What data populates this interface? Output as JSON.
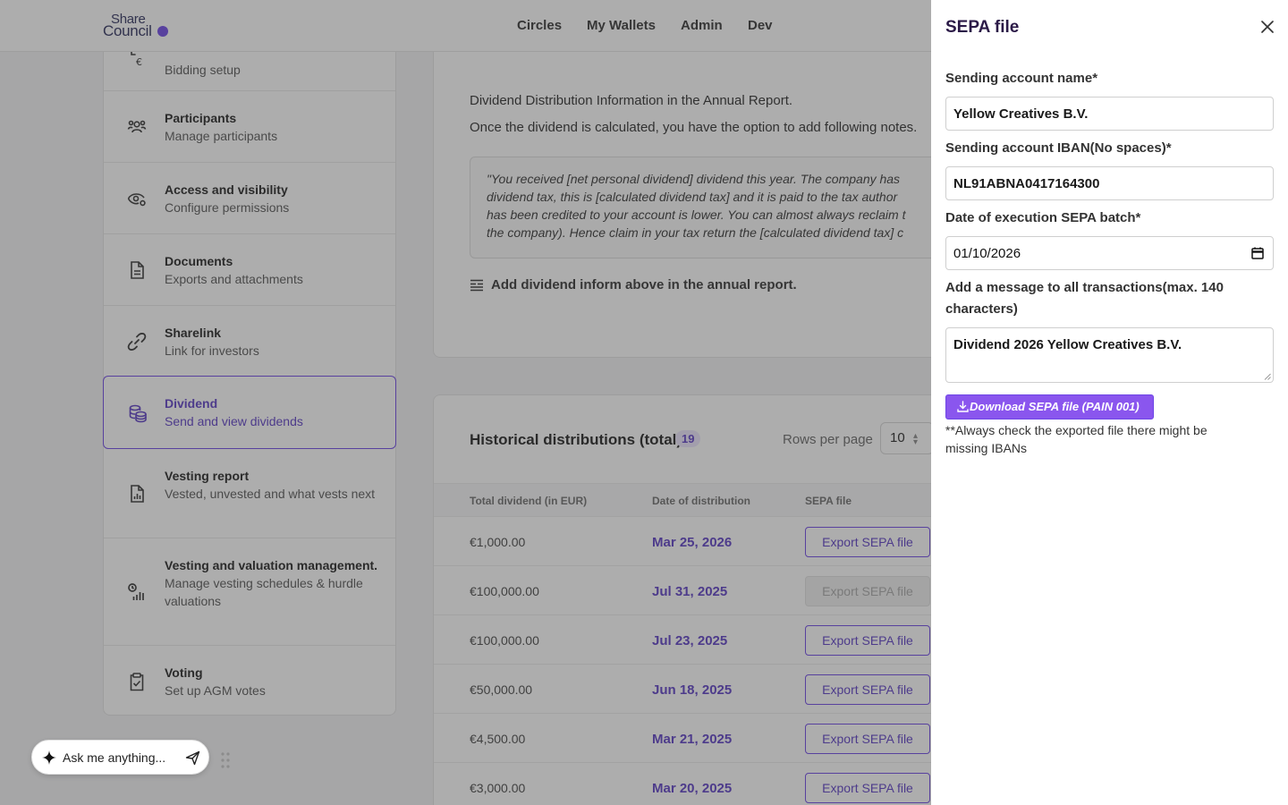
{
  "header": {
    "logo_line1": "Share",
    "logo_line2": "Council",
    "nav": [
      "Circles",
      "My Wallets",
      "Admin",
      "Dev"
    ]
  },
  "sidebar": {
    "items": [
      {
        "title": "",
        "desc": "Bidding setup",
        "icon": "euro-bid-icon"
      },
      {
        "title": "Participants",
        "desc": "Manage participants",
        "icon": "users-icon"
      },
      {
        "title": "Access and visibility",
        "desc": "Configure permissions",
        "icon": "eye-cog-icon"
      },
      {
        "title": "Documents",
        "desc": "Exports and attachments",
        "icon": "document-icon"
      },
      {
        "title": "Sharelink",
        "desc": "Link for investors",
        "icon": "link-icon"
      },
      {
        "title": "Dividend",
        "desc": "Send and view dividends",
        "icon": "coins-icon",
        "active": true
      },
      {
        "title": "Vesting report",
        "desc": "Vested, unvested and what vests next",
        "icon": "report-icon"
      },
      {
        "title": "Vesting and valuation management.",
        "desc": "Manage vesting schedules & hurdle valuations",
        "icon": "chart-clock-icon"
      },
      {
        "title": "Voting",
        "desc": "Set up AGM votes",
        "icon": "clipboard-check-icon"
      }
    ]
  },
  "dividend_info": {
    "line1": "Dividend Distribution Information in the Annual Report.",
    "line2": "Once the dividend is calculated, you have the option to add following notes.",
    "quote_lines": [
      "\"You received [net personal dividend] dividend this year. The company has",
      "dividend tax, this is [calculated dividend tax] and it is paid to the tax author",
      "has been credited to your account is lower. You can almost always reclaim t",
      "the company). Hence claim in your tax return the [calculated dividend tax] c"
    ],
    "add_note_label": "Add dividend inform above in the annual report."
  },
  "history": {
    "title": "Historical distributions (total)",
    "count": "19",
    "rows_per_page_label": "Rows per page",
    "rows_per_page": "10",
    "columns": [
      "Total dividend (in EUR)",
      "Date of distribution",
      "SEPA file"
    ],
    "rows": [
      {
        "amount": "€1,000.00",
        "date": "Mar 25, 2026",
        "action": "Export SEPA file",
        "disabled": false
      },
      {
        "amount": "€100,000.00",
        "date": "Jul 31, 2025",
        "action": "Export SEPA file",
        "disabled": true
      },
      {
        "amount": "€100,000.00",
        "date": "Jul 23, 2025",
        "action": "Export SEPA file",
        "disabled": false
      },
      {
        "amount": "€50,000.00",
        "date": "Jun 18, 2025",
        "action": "Export SEPA file",
        "disabled": false
      },
      {
        "amount": "€4,500.00",
        "date": "Mar 21, 2025",
        "action": "Export SEPA file",
        "disabled": false
      },
      {
        "amount": "€3,000.00",
        "date": "Mar 20, 2025",
        "action": "Export SEPA file",
        "disabled": false
      }
    ]
  },
  "chat": {
    "placeholder": "Ask me anything..."
  },
  "drawer": {
    "title": "SEPA file",
    "fields": {
      "account_name_label": "Sending account name*",
      "account_name_value": "Yellow Creatives B.V.",
      "iban_label": "Sending account IBAN(No spaces)*",
      "iban_value": "NL91ABNA0417164300",
      "date_label": "Date of execution SEPA batch*",
      "date_value": "01/10/2026",
      "message_label": "Add a message to all transactions(max. 140 characters)",
      "message_value": "Dividend 2026 Yellow Creatives B.V."
    },
    "download_label": "Download SEPA file (PAIN 001)",
    "note": "**Always check the exported file there might be missing IBANs"
  },
  "colors": {
    "accent": "#6d45e6",
    "accent_text": "#5b3cc4",
    "button_fill": "#8a56ee"
  }
}
